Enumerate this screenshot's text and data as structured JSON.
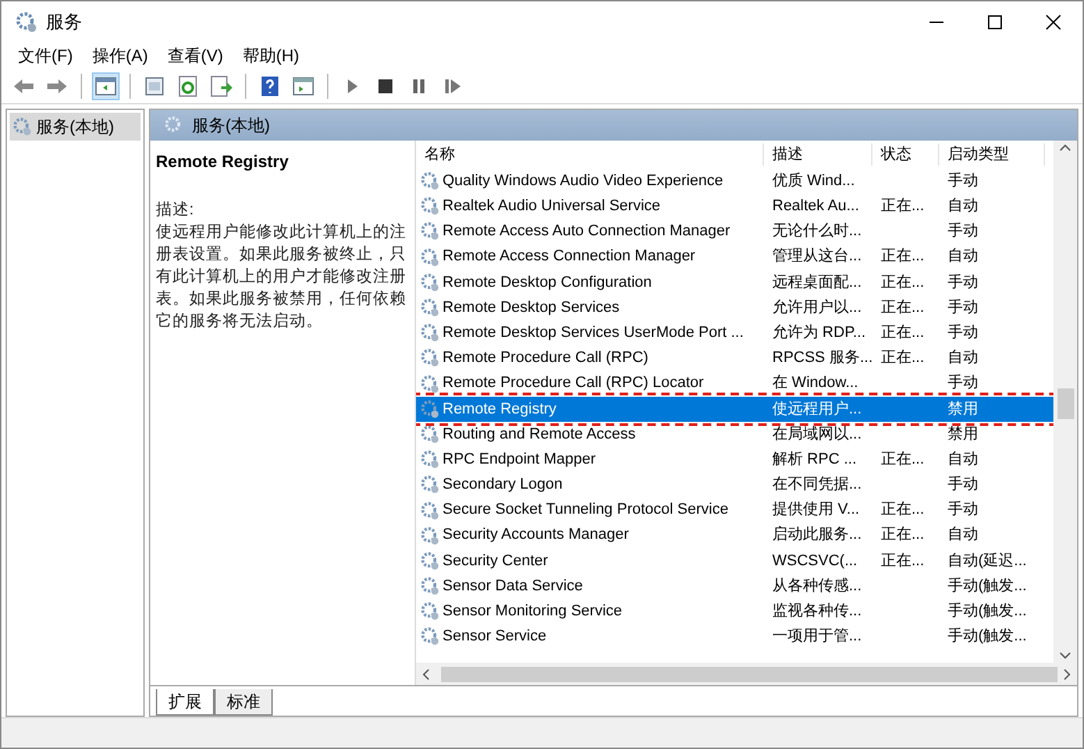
{
  "window": {
    "title": "服务"
  },
  "menu": [
    "文件(F)",
    "操作(A)",
    "查看(V)",
    "帮助(H)"
  ],
  "tree": {
    "items": [
      {
        "label": "服务(本地)",
        "selected": true
      }
    ]
  },
  "panel_header": "服务(本地)",
  "details": {
    "title": "Remote Registry",
    "label": "描述:",
    "text": "使远程用户能修改此计算机上的注册表设置。如果此服务被终止，只有此计算机上的用户才能修改注册表。如果此服务被禁用，任何依赖它的服务将无法启动。"
  },
  "table": {
    "columns": [
      "名称",
      "描述",
      "状态",
      "启动类型"
    ],
    "rows": [
      {
        "name": "Quality Windows Audio Video Experience",
        "description": "优质 Wind...",
        "status": "",
        "startup": "手动",
        "selected": false
      },
      {
        "name": "Realtek Audio Universal Service",
        "description": "Realtek Au...",
        "status": "正在...",
        "startup": "自动",
        "selected": false
      },
      {
        "name": "Remote Access Auto Connection Manager",
        "description": "无论什么时...",
        "status": "",
        "startup": "手动",
        "selected": false
      },
      {
        "name": "Remote Access Connection Manager",
        "description": "管理从这台...",
        "status": "正在...",
        "startup": "自动",
        "selected": false
      },
      {
        "name": "Remote Desktop Configuration",
        "description": "远程桌面配...",
        "status": "正在...",
        "startup": "手动",
        "selected": false
      },
      {
        "name": "Remote Desktop Services",
        "description": "允许用户以...",
        "status": "正在...",
        "startup": "手动",
        "selected": false
      },
      {
        "name": "Remote Desktop Services UserMode Port ...",
        "description": "允许为 RDP...",
        "status": "正在...",
        "startup": "手动",
        "selected": false
      },
      {
        "name": "Remote Procedure Call (RPC)",
        "description": "RPCSS 服务...",
        "status": "正在...",
        "startup": "自动",
        "selected": false
      },
      {
        "name": "Remote Procedure Call (RPC) Locator",
        "description": "在 Window...",
        "status": "",
        "startup": "手动",
        "selected": false
      },
      {
        "name": "Remote Registry",
        "description": "使远程用户...",
        "status": "",
        "startup": "禁用",
        "selected": true
      },
      {
        "name": "Routing and Remote Access",
        "description": "在局域网以...",
        "status": "",
        "startup": "禁用",
        "selected": false
      },
      {
        "name": "RPC Endpoint Mapper",
        "description": "解析 RPC ...",
        "status": "正在...",
        "startup": "自动",
        "selected": false
      },
      {
        "name": "Secondary Logon",
        "description": "在不同凭据...",
        "status": "",
        "startup": "手动",
        "selected": false
      },
      {
        "name": "Secure Socket Tunneling Protocol Service",
        "description": "提供使用 V...",
        "status": "正在...",
        "startup": "手动",
        "selected": false
      },
      {
        "name": "Security Accounts Manager",
        "description": "启动此服务...",
        "status": "正在...",
        "startup": "自动",
        "selected": false
      },
      {
        "name": "Security Center",
        "description": "WSCSVC(...",
        "status": "正在...",
        "startup": "自动(延迟...",
        "selected": false
      },
      {
        "name": "Sensor Data Service",
        "description": "从各种传感...",
        "status": "",
        "startup": "手动(触发...",
        "selected": false
      },
      {
        "name": "Sensor Monitoring Service",
        "description": "监视各种传...",
        "status": "",
        "startup": "手动(触发...",
        "selected": false
      },
      {
        "name": "Sensor Service",
        "description": "一项用于管...",
        "status": "",
        "startup": "手动(触发...",
        "selected": false
      }
    ]
  },
  "tabs": [
    {
      "label": "扩展",
      "selected": true
    },
    {
      "label": "标准",
      "selected": false
    }
  ]
}
